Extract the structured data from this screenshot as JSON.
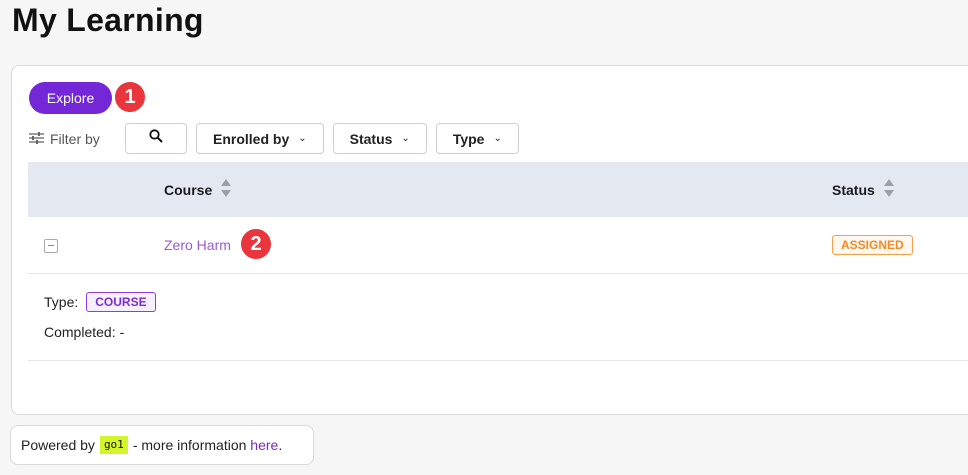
{
  "page": {
    "title": "My Learning"
  },
  "toolbar": {
    "explore_label": "Explore",
    "markers": [
      "1",
      "2"
    ]
  },
  "filters": {
    "label": "Filter by",
    "dropdowns": [
      "Enrolled by",
      "Status",
      "Type"
    ]
  },
  "table": {
    "columns": [
      "Course",
      "Status"
    ],
    "rows": [
      {
        "course": "Zero Harm",
        "status": "ASSIGNED",
        "details": {
          "type_label": "Type:",
          "type_value": "COURSE",
          "completed_label": "Completed:",
          "completed_value": "-"
        }
      }
    ]
  },
  "footer": {
    "powered_by": "Powered by",
    "logo_text": "go1",
    "more_info": "- more information",
    "link_text": "here",
    "suffix": "."
  },
  "colors": {
    "accent": "#7327d6",
    "marker": "#e8363c",
    "status_assigned": "#f08a22",
    "header_bg": "#e4e9f1"
  }
}
